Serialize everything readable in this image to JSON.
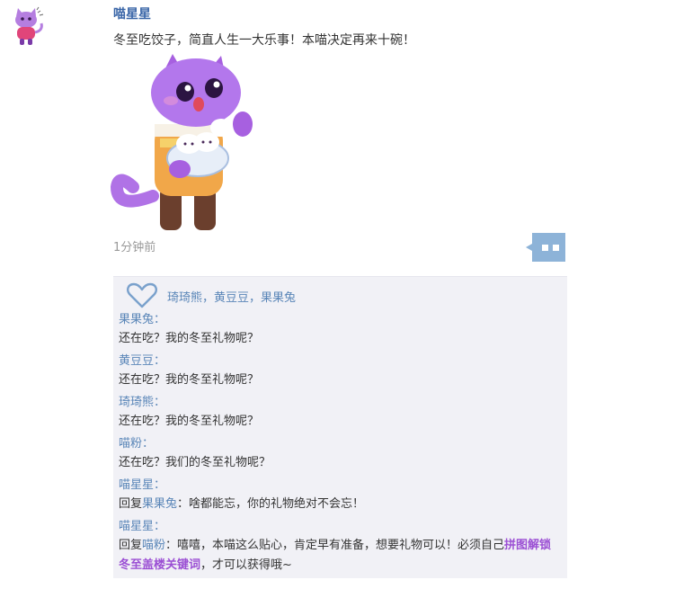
{
  "post": {
    "author": "喵星星",
    "text": "冬至吃饺子，简直人生一大乐事！本喵决定再来十碗！",
    "time": "1分钟前",
    "likes": "琦琦熊，黄豆豆，果果兔"
  },
  "replies": [
    {
      "author": "果果兔：",
      "text": "还在吃？我的冬至礼物呢？"
    },
    {
      "author": "黄豆豆：",
      "text": "还在吃？我的冬至礼物呢？"
    },
    {
      "author": "琦琦熊：",
      "text": "还在吃？我的冬至礼物呢？"
    },
    {
      "author": "喵粉：",
      "text": "还在吃？我们的冬至礼物呢？"
    }
  ],
  "reply_to_1": {
    "author": "喵星星：",
    "prefix": "回复",
    "mention": "果果兔",
    "text": "：啥都能忘，你的礼物绝对不会忘！"
  },
  "reply_to_2": {
    "author": "喵星星：",
    "prefix": "回复",
    "mention": "喵粉",
    "text_a": "：嘻嘻，本喵这么贴心，肯定早有准备，想要礼物可以！必须自己",
    "highlight": "拼图解锁冬至盖楼关键词",
    "text_b": "，才可以获得哦~"
  },
  "colors": {
    "author": "#3a66a8",
    "link": "#5a86b8",
    "highlight": "#9b4fd4",
    "panel_bg": "#f1f1f6",
    "comment_button": "#8db3d8"
  },
  "icons": {
    "avatar": "purple-cat-avatar",
    "mascot": "purple-cat-eating-dumplings",
    "comment": "comment-bubble-icon",
    "like": "heart-outline-icon"
  }
}
